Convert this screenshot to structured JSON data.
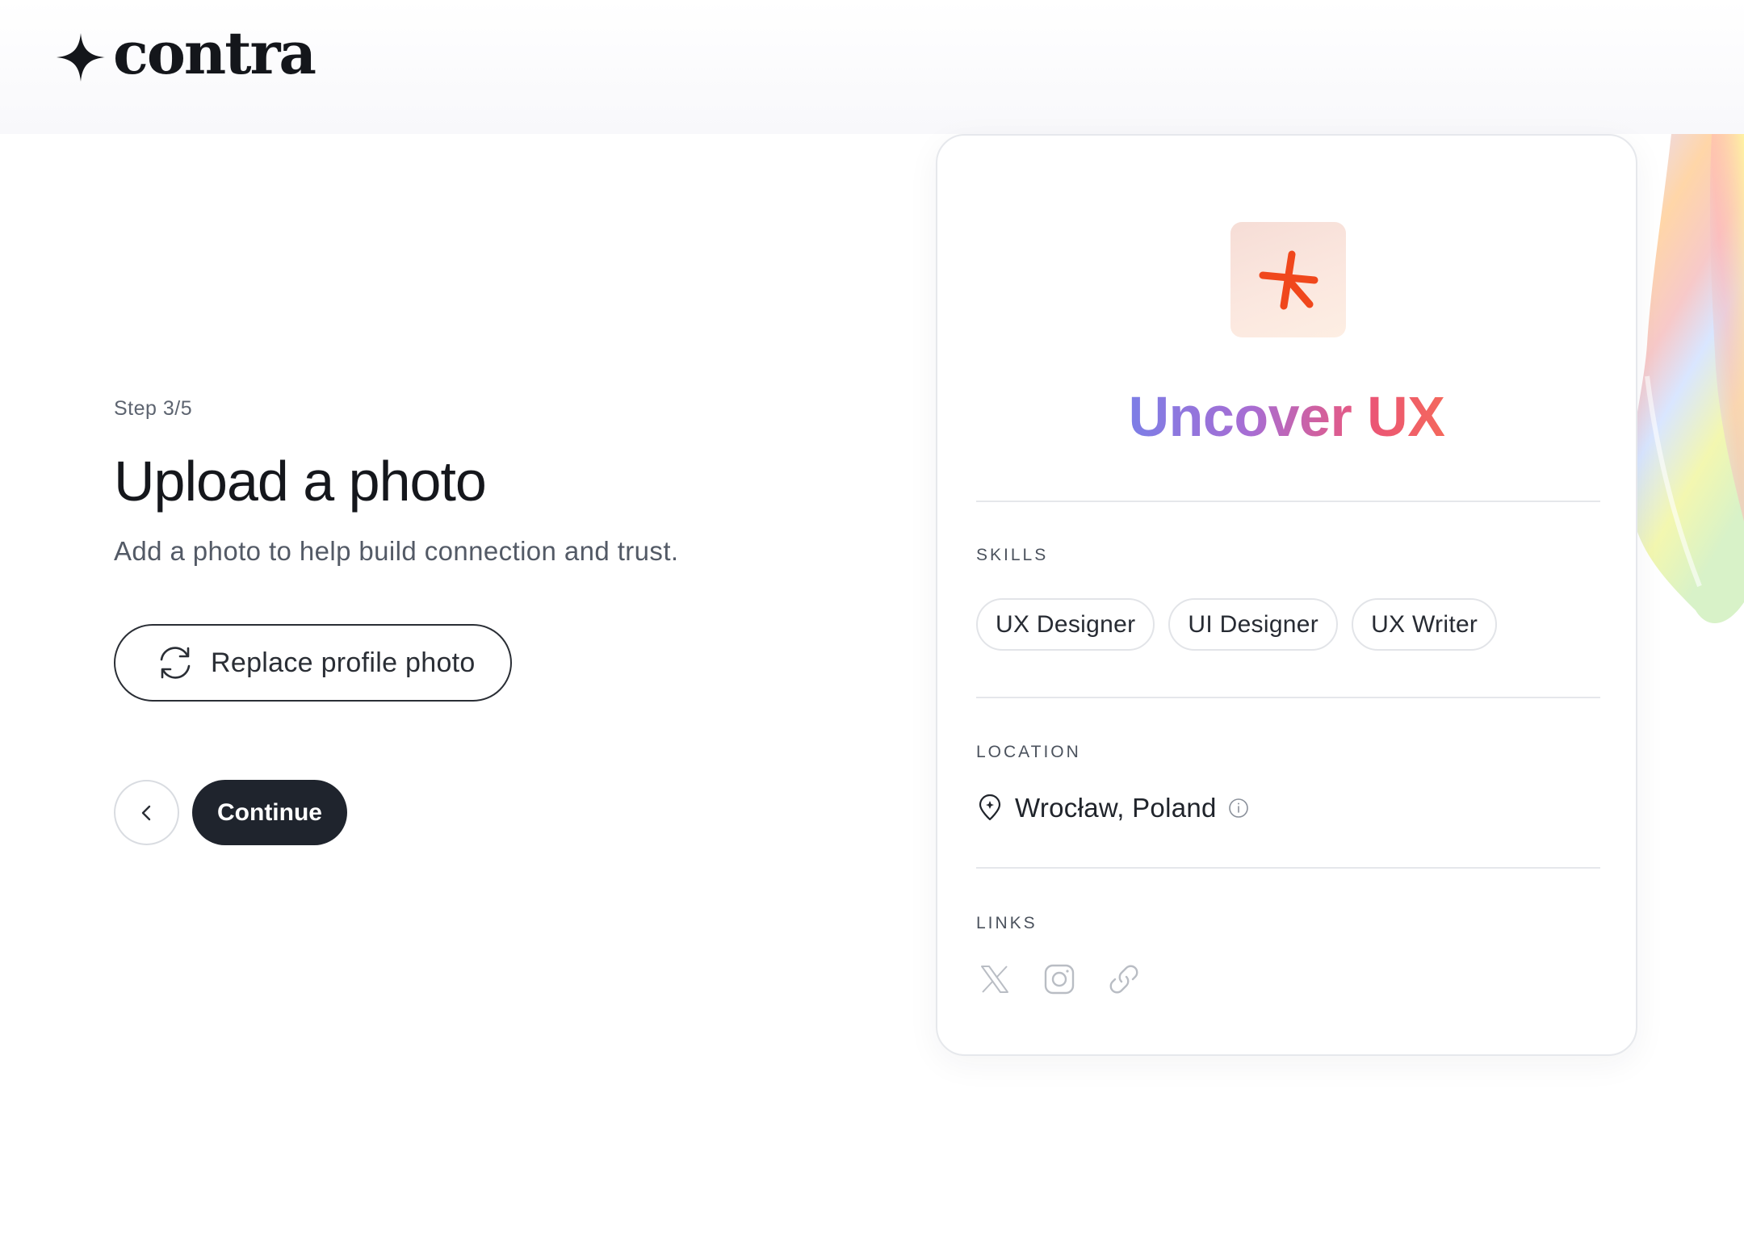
{
  "app": {
    "brand_name": "contra"
  },
  "onboarding": {
    "step_label": "Step 3/5",
    "title": "Upload a photo",
    "subtitle": "Add a photo to help build connection and trust.",
    "replace_photo_label": "Replace profile photo",
    "continue_label": "Continue",
    "back_icon": "chevron-left-icon"
  },
  "profile_card": {
    "name_first": "Uncover",
    "name_second": "UX",
    "skills_label": "SKILLS",
    "skills": [
      "UX Designer",
      "UI Designer",
      "UX Writer"
    ],
    "location_label": "LOCATION",
    "location": "Wrocław, Poland",
    "links_label": "LINKS",
    "links": [
      {
        "icon": "x-twitter-icon"
      },
      {
        "icon": "instagram-icon"
      },
      {
        "icon": "link-icon"
      }
    ]
  },
  "colors": {
    "primary_button": "#1f242d",
    "avatar_accent": "#f0471c",
    "name_gradient_start": "#7c7ee6",
    "name_accent": "#ea5477"
  }
}
